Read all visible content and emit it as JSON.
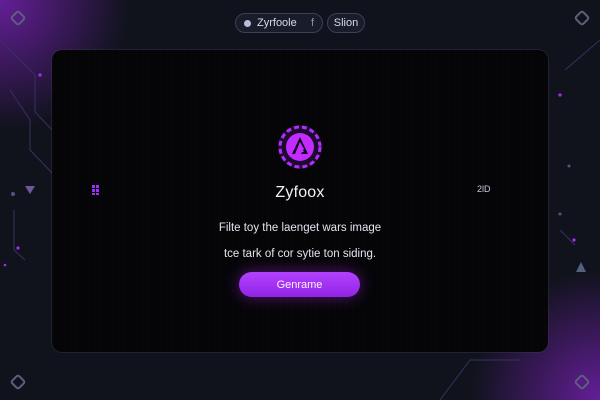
{
  "header": {
    "brand_label": "Zyrfoole",
    "brand_suffix": "f",
    "action_label": "Slion"
  },
  "hero": {
    "title": "Zyfoox",
    "description_line1": "Filte toy the laenget wars image",
    "description_line2": "tce tark of cor sytie ton siding.",
    "button_label": "Genrame"
  },
  "side": {
    "right_label": "2lD"
  },
  "icons": {
    "logo": "zyfoox-logo-icon",
    "grid": "grid-icon"
  },
  "colors": {
    "accent": "#a72cff",
    "background": "#10131c",
    "panel": "#050507"
  }
}
